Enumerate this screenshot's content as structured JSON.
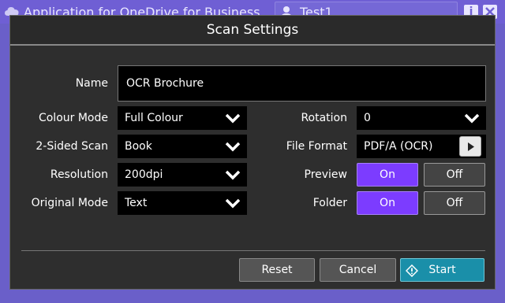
{
  "app": {
    "title": "Application for OneDrive for Business",
    "user": "Test1",
    "info_glyph": "i"
  },
  "dialog": {
    "title": "Scan Settings",
    "name_label": "Name",
    "name_value": "OCR Brochure",
    "left_fields": [
      {
        "label": "Colour Mode",
        "value": "Full Colour"
      },
      {
        "label": "2-Sided Scan",
        "value": "Book"
      },
      {
        "label": "Resolution",
        "value": "200dpi"
      },
      {
        "label": "Original Mode",
        "value": "Text"
      }
    ],
    "rotation": {
      "label": "Rotation",
      "value": "0"
    },
    "file_format": {
      "label": "File Format",
      "value": "PDF/A (OCR)"
    },
    "preview": {
      "label": "Preview",
      "on": "On",
      "off": "Off",
      "selected": "On"
    },
    "folder": {
      "label": "Folder",
      "on": "On",
      "off": "Off",
      "selected": "On"
    },
    "buttons": {
      "reset": "Reset",
      "cancel": "Cancel",
      "start": "Start"
    }
  },
  "colors": {
    "accent_on": "#7c3cff",
    "start": "#1a8fa9",
    "app_bar": "#6f5fd4"
  },
  "icons": [
    "cloud-icon",
    "user-icon",
    "info-icon",
    "close-icon",
    "chevron-down-icon",
    "play-icon",
    "start-icon"
  ]
}
